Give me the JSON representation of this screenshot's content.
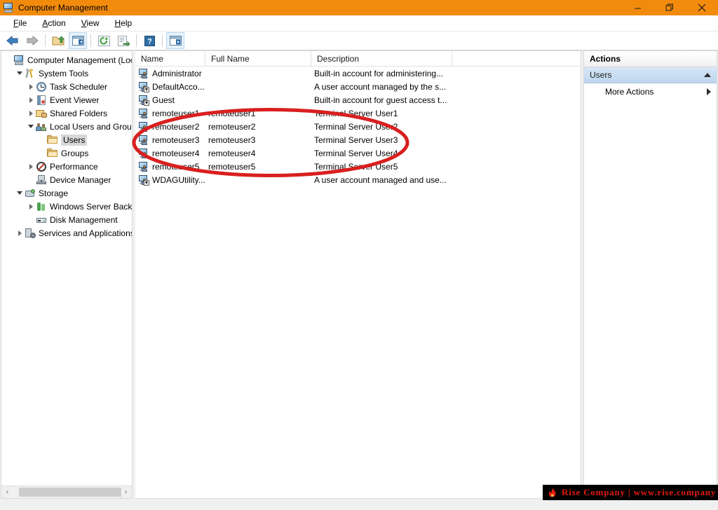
{
  "window": {
    "title": "Computer Management",
    "title_icon": "computer-icon",
    "controls": {
      "minimize": "minimize-icon",
      "restore": "restore-icon",
      "close": "close-icon"
    },
    "titlebar_color": "#f28b0c"
  },
  "menu": {
    "items": [
      {
        "label": "File",
        "accesskey": "F"
      },
      {
        "label": "Action",
        "accesskey": "A"
      },
      {
        "label": "View",
        "accesskey": "V"
      },
      {
        "label": "Help",
        "accesskey": "H"
      }
    ]
  },
  "toolbar": {
    "buttons": [
      {
        "name": "back-button",
        "icon": "back-arrow-icon",
        "framed": false
      },
      {
        "name": "forward-button",
        "icon": "forward-arrow-icon",
        "framed": false
      },
      {
        "name": "up-one-level-button",
        "icon": "up-folder-icon",
        "framed": false
      },
      {
        "name": "show-hide-tree-button",
        "icon": "console-tree-icon",
        "framed": true
      },
      {
        "name": "refresh-button",
        "icon": "refresh-icon",
        "framed": false
      },
      {
        "name": "export-list-button",
        "icon": "export-list-icon",
        "framed": false
      },
      {
        "name": "help-button",
        "icon": "help-question-icon",
        "framed": false
      },
      {
        "name": "properties-button",
        "icon": "console-pane-icon",
        "framed": true
      }
    ]
  },
  "tree": {
    "items": [
      {
        "label": "Computer Management (Local",
        "icon": "computer-management-icon",
        "indent": 0,
        "expander": "none",
        "selected": false
      },
      {
        "label": "System Tools",
        "icon": "system-tools-icon",
        "indent": 1,
        "expander": "down",
        "selected": false
      },
      {
        "label": "Task Scheduler",
        "icon": "clock-icon",
        "indent": 2,
        "expander": "right",
        "selected": false
      },
      {
        "label": "Event Viewer",
        "icon": "event-viewer-icon",
        "indent": 2,
        "expander": "right",
        "selected": false
      },
      {
        "label": "Shared Folders",
        "icon": "shared-folders-icon",
        "indent": 2,
        "expander": "right",
        "selected": false
      },
      {
        "label": "Local Users and Groups",
        "icon": "local-users-groups-icon",
        "indent": 2,
        "expander": "down",
        "selected": false
      },
      {
        "label": "Users",
        "icon": "folder-icon",
        "indent": 3,
        "expander": "none",
        "selected": true
      },
      {
        "label": "Groups",
        "icon": "folder-icon",
        "indent": 3,
        "expander": "none",
        "selected": false
      },
      {
        "label": "Performance",
        "icon": "performance-icon",
        "indent": 2,
        "expander": "right",
        "selected": false
      },
      {
        "label": "Device Manager",
        "icon": "device-manager-icon",
        "indent": 2,
        "expander": "none",
        "selected": false
      },
      {
        "label": "Storage",
        "icon": "storage-icon",
        "indent": 1,
        "expander": "down",
        "selected": false
      },
      {
        "label": "Windows Server Backup",
        "icon": "backup-icon",
        "indent": 2,
        "expander": "right",
        "selected": false
      },
      {
        "label": "Disk Management",
        "icon": "disk-management-icon",
        "indent": 2,
        "expander": "none",
        "selected": false
      },
      {
        "label": "Services and Applications",
        "icon": "services-apps-icon",
        "indent": 1,
        "expander": "right",
        "selected": false
      }
    ],
    "scrollbar": {
      "left_arrow": "‹",
      "right_arrow": "›"
    }
  },
  "list": {
    "columns": [
      "Name",
      "Full Name",
      "Description"
    ],
    "rows": [
      {
        "name": "Administrator",
        "full_name": "",
        "description": "Built-in account for administering...",
        "icon": "user-account-icon",
        "disabled": false
      },
      {
        "name": "DefaultAcco...",
        "full_name": "",
        "description": "A user account managed by the s...",
        "icon": "user-account-disabled-icon",
        "disabled": true
      },
      {
        "name": "Guest",
        "full_name": "",
        "description": "Built-in account for guest access t...",
        "icon": "user-account-disabled-icon",
        "disabled": true
      },
      {
        "name": "remoteuser1",
        "full_name": "remoteuser1",
        "description": "Terminal Server User1",
        "icon": "user-account-icon",
        "disabled": false
      },
      {
        "name": "remoteuser2",
        "full_name": "remoteuser2",
        "description": "Terminal Server User2",
        "icon": "user-account-icon",
        "disabled": false
      },
      {
        "name": "remoteuser3",
        "full_name": "remoteuser3",
        "description": "Terminal Server User3",
        "icon": "user-account-icon",
        "disabled": false
      },
      {
        "name": "remoteuser4",
        "full_name": "remoteuser4",
        "description": "Terminal Server User4",
        "icon": "user-account-icon",
        "disabled": false
      },
      {
        "name": "remoteuser5",
        "full_name": "remoteuser5",
        "description": "Terminal Server User5",
        "icon": "user-account-icon",
        "disabled": false
      },
      {
        "name": "WDAGUtility...",
        "full_name": "",
        "description": "A user account managed and use...",
        "icon": "user-account-disabled-icon",
        "disabled": true
      }
    ]
  },
  "actions": {
    "title": "Actions",
    "group_label": "Users",
    "group_collapse_icon": "triangle-up-icon",
    "items": [
      {
        "label": "More Actions",
        "submenu_icon": "triangle-right-icon"
      }
    ]
  },
  "annotation": {
    "shape": "ellipse",
    "color": "#d91f1f",
    "stroke_width": 5,
    "highlights_rows": [
      "remoteuser1",
      "remoteuser2",
      "remoteuser3",
      "remoteuser4",
      "remoteuser5"
    ]
  },
  "watermark": {
    "text": "Rise Company | www.rise.company",
    "logo": "flame-hand-icon",
    "text_color": "#e01b12",
    "background_color": "#000000"
  }
}
